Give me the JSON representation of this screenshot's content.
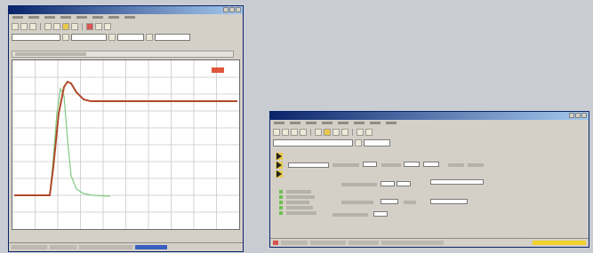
{
  "screen": {
    "background": "#c9ccd2"
  },
  "window_left": {
    "title": "",
    "menu_items": 8,
    "toolbar_rows": 2,
    "plot": {
      "title": "",
      "chart_type": "line",
      "grid": true,
      "series": [
        {
          "name": "",
          "color": "#b04a2a",
          "description_of_shape": "step response with overshoot"
        },
        {
          "name": "",
          "color": "#7fc97f",
          "description_of_shape": "settling transient"
        }
      ]
    },
    "status": {
      "accent": "#3a5fbf"
    }
  },
  "window_right": {
    "title": "",
    "menu_items": 8,
    "status": {
      "accent": "#f2d12e"
    },
    "icons": [
      "arrow-right-icon",
      "arrow-right-icon",
      "arrow-right-icon"
    ]
  }
}
